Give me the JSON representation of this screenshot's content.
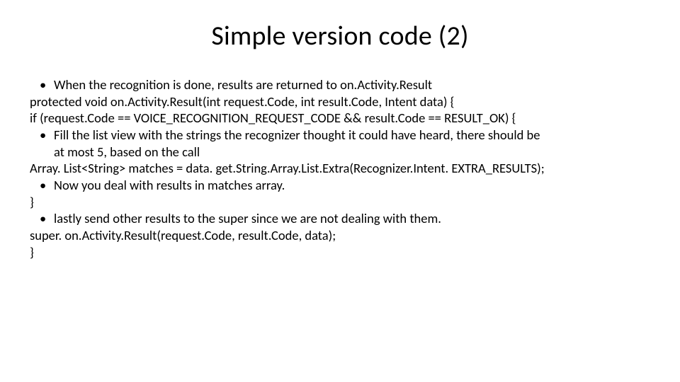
{
  "slide": {
    "title": "Simple version code (2)",
    "lines": {
      "l1": "When the recognition is done, results are returned to on.Activity.Result",
      "l2": " protected void on.Activity.Result(int request.Code, int result.Code, Intent data) {",
      "l3": " if (request.Code == VOICE_RECOGNITION_REQUEST_CODE && result.Code == RESULT_OK) {",
      "l4a": "Fill the list view with the strings the recognizer thought it could have heard, there should be",
      "l4b": "at most 5, based on the call",
      "l5": "Array. List<String> matches = data. get.String.Array.List.Extra(Recognizer.Intent. EXTRA_RESULTS);",
      "l6": "Now you deal with results in matches array.",
      "l7": "}",
      "l8": " lastly send other results to the super since we are not dealing with them.",
      "l9": "super. on.Activity.Result(request.Code, result.Code, data);",
      "l10": "}"
    }
  }
}
